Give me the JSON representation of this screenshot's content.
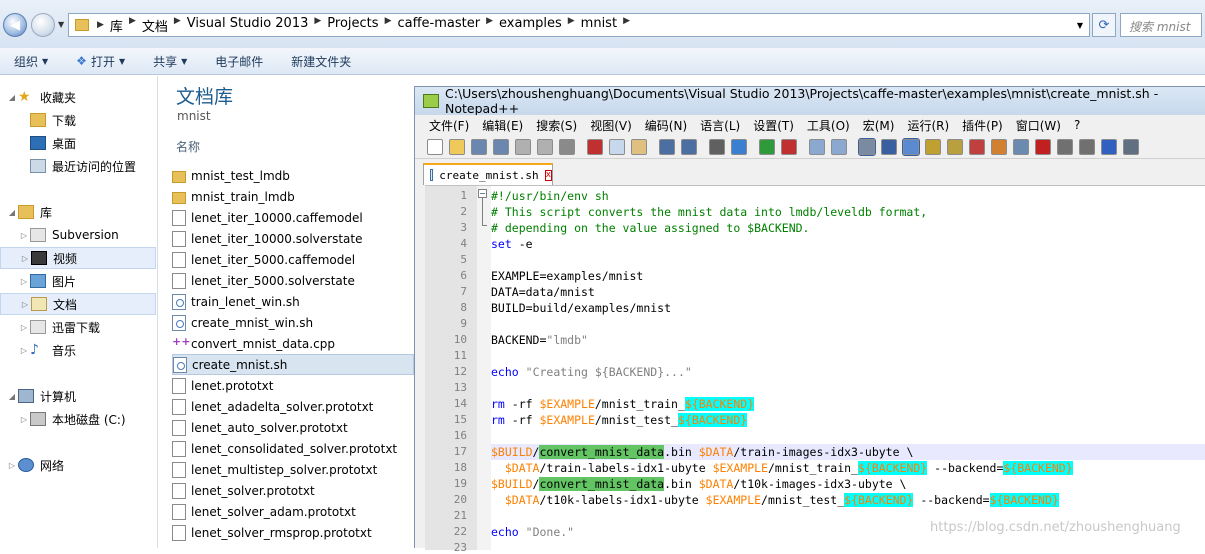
{
  "address": {
    "crumbs": [
      "库",
      "文档",
      "Visual Studio 2013",
      "Projects",
      "caffe-master",
      "examples",
      "mnist"
    ],
    "search_placeholder": "搜索 mnist"
  },
  "toolbar": {
    "organize": "组织",
    "open": "打开",
    "share": "共享",
    "email": "电子邮件",
    "new_folder": "新建文件夹"
  },
  "nav": {
    "favorites": "收藏夹",
    "downloads": "下载",
    "desktop": "桌面",
    "recent": "最近访问的位置",
    "libraries": "库",
    "subversion": "Subversion",
    "videos": "视频",
    "pictures": "图片",
    "documents": "文档",
    "thunder": "迅雷下载",
    "music": "音乐",
    "computer": "计算机",
    "local_disk": "本地磁盘 (C:)",
    "network": "网络"
  },
  "files": {
    "library_title": "文档库",
    "library_sub": "mnist",
    "column_name": "名称",
    "items": [
      {
        "name": "mnist_test_lmdb",
        "type": "folder"
      },
      {
        "name": "mnist_train_lmdb",
        "type": "folder"
      },
      {
        "name": "lenet_iter_10000.caffemodel",
        "type": "doc"
      },
      {
        "name": "lenet_iter_10000.solverstate",
        "type": "doc"
      },
      {
        "name": "lenet_iter_5000.caffemodel",
        "type": "doc"
      },
      {
        "name": "lenet_iter_5000.solverstate",
        "type": "doc"
      },
      {
        "name": "train_lenet_win.sh",
        "type": "sh"
      },
      {
        "name": "create_mnist_win.sh",
        "type": "sh"
      },
      {
        "name": "convert_mnist_data.cpp",
        "type": "cpp"
      },
      {
        "name": "create_mnist.sh",
        "type": "sh",
        "selected": true
      },
      {
        "name": "lenet.prototxt",
        "type": "doc"
      },
      {
        "name": "lenet_adadelta_solver.prototxt",
        "type": "doc"
      },
      {
        "name": "lenet_auto_solver.prototxt",
        "type": "doc"
      },
      {
        "name": "lenet_consolidated_solver.prototxt",
        "type": "doc"
      },
      {
        "name": "lenet_multistep_solver.prototxt",
        "type": "doc"
      },
      {
        "name": "lenet_solver.prototxt",
        "type": "doc"
      },
      {
        "name": "lenet_solver_adam.prototxt",
        "type": "doc"
      },
      {
        "name": "lenet_solver_rmsprop.prototxt",
        "type": "doc"
      }
    ]
  },
  "npp": {
    "title": "C:\\Users\\zhoushenghuang\\Documents\\Visual Studio 2013\\Projects\\caffe-master\\examples\\mnist\\create_mnist.sh - Notepad++",
    "menu": [
      "文件(F)",
      "编辑(E)",
      "搜索(S)",
      "视图(V)",
      "编码(N)",
      "语言(L)",
      "设置(T)",
      "工具(O)",
      "宏(M)",
      "运行(R)",
      "插件(P)",
      "窗口(W)",
      "?"
    ],
    "tab": "create_mnist.sh",
    "line_numbers": [
      "1",
      "2",
      "3",
      "4",
      "5",
      "6",
      "7",
      "8",
      "9",
      "10",
      "11",
      "12",
      "13",
      "14",
      "15",
      "16",
      "17",
      "18",
      "19",
      "20",
      "21",
      "22",
      "23"
    ]
  },
  "code": [
    [
      {
        "t": "#!/usr/bin/env sh",
        "c": "cm"
      }
    ],
    [
      {
        "t": "# This script converts the mnist data into lmdb/leveldb format,",
        "c": "cm"
      }
    ],
    [
      {
        "t": "# depending on the value assigned to $BACKEND.",
        "c": "cm"
      }
    ],
    [
      {
        "t": "set",
        "c": "kw"
      },
      {
        "t": " -e"
      }
    ],
    [],
    [
      {
        "t": "EXAMPLE=examples/mnist"
      }
    ],
    [
      {
        "t": "DATA=data/mnist"
      }
    ],
    [
      {
        "t": "BUILD=build/examples/mnist"
      }
    ],
    [],
    [
      {
        "t": "BACKEND="
      },
      {
        "t": "\"lmdb\"",
        "c": "st"
      }
    ],
    [],
    [
      {
        "t": "echo",
        "c": "kw"
      },
      {
        "t": " "
      },
      {
        "t": "\"Creating ${BACKEND}...\"",
        "c": "st"
      }
    ],
    [],
    [
      {
        "t": "rm",
        "c": "kw"
      },
      {
        "t": " -rf "
      },
      {
        "t": "$EXAMPLE",
        "c": "va"
      },
      {
        "t": "/mnist_train_"
      },
      {
        "t": "${BACKEND}",
        "c": "hl"
      }
    ],
    [
      {
        "t": "rm",
        "c": "kw"
      },
      {
        "t": " -rf "
      },
      {
        "t": "$EXAMPLE",
        "c": "va"
      },
      {
        "t": "/mnist_test_"
      },
      {
        "t": "${BACKEND}",
        "c": "hl"
      }
    ],
    [],
    [
      {
        "t": "$BUILD",
        "c": "va"
      },
      {
        "t": "/"
      },
      {
        "t": "convert_mnist_data",
        "c": "gr"
      },
      {
        "t": ".bin "
      },
      {
        "t": "$DATA",
        "c": "va"
      },
      {
        "t": "/train-images-idx3-ubyte \\"
      }
    ],
    [
      {
        "t": "  "
      },
      {
        "t": "$DATA",
        "c": "va"
      },
      {
        "t": "/train-labels-idx1-ubyte "
      },
      {
        "t": "$EXAMPLE",
        "c": "va"
      },
      {
        "t": "/mnist_train_"
      },
      {
        "t": "${BACKEND}",
        "c": "hl"
      },
      {
        "t": " --backend="
      },
      {
        "t": "${BACKEND}",
        "c": "hl"
      }
    ],
    [
      {
        "t": "$BUILD",
        "c": "va"
      },
      {
        "t": "/"
      },
      {
        "t": "convert_mnist_data",
        "c": "gr"
      },
      {
        "t": ".bin "
      },
      {
        "t": "$DATA",
        "c": "va"
      },
      {
        "t": "/t10k-images-idx3-ubyte \\"
      }
    ],
    [
      {
        "t": "  "
      },
      {
        "t": "$DATA",
        "c": "va"
      },
      {
        "t": "/t10k-labels-idx1-ubyte "
      },
      {
        "t": "$EXAMPLE",
        "c": "va"
      },
      {
        "t": "/mnist_test_"
      },
      {
        "t": "${BACKEND}",
        "c": "hl"
      },
      {
        "t": " --backend="
      },
      {
        "t": "${BACKEND}",
        "c": "hl"
      }
    ],
    [],
    [
      {
        "t": "echo",
        "c": "kw"
      },
      {
        "t": " "
      },
      {
        "t": "\"Done.\"",
        "c": "st"
      }
    ],
    []
  ],
  "current_line": 17,
  "watermark": "https://blog.csdn.net/zhoushenghuang"
}
